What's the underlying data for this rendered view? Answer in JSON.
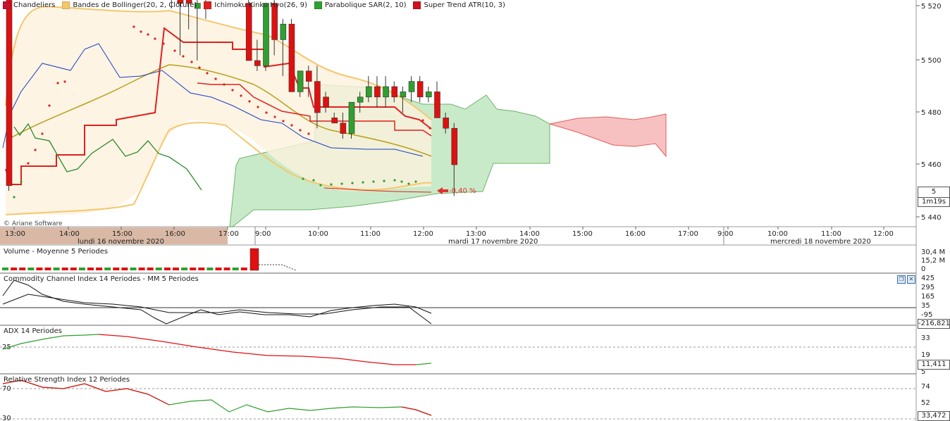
{
  "legend": [
    {
      "label": "Chandeliers",
      "color": "#c8102e"
    },
    {
      "label": "Bandes de Bollinger(20, 2, Clôture)",
      "color": "#f5c76a"
    },
    {
      "label": "Ichimoku Kinko Hyo(26, 9)",
      "color": "#e02020"
    },
    {
      "label": "Parabolique SAR(2, 10)",
      "color": "#2fa02f"
    },
    {
      "label": "Super Trend ATR(10, 3)",
      "color": "#d0101c"
    }
  ],
  "brand": "© Ariane Software",
  "price_badge": "5 449,80",
  "timer_badge": "1m19s",
  "pct_change": "-0,40 %",
  "panes": {
    "volume_title": "Volume  - Moyenne 5 Periodes",
    "cci_title": "Commodity Channel Index 14 Periodes - MM  5 Periodes",
    "adx_title": "ADX 14 Periodes",
    "rsi_title": "Relative Strength Index 12 Periodes",
    "cci_badge": "-216,821",
    "adx_badge": "11,411",
    "rsi_badge": "33,472"
  },
  "controls": {
    "restore_icon": "restore-icon",
    "close_icon": "close-icon"
  },
  "chart_data": {
    "type": "candlestick",
    "price_axis_ticks": [
      "5 520",
      "5 500",
      "5 480",
      "5 460",
      "5 440"
    ],
    "price_ylim": [
      5440,
      5520
    ],
    "time_ticks": [
      "13:00",
      "14:00",
      "15:00",
      "16:00",
      "17:00",
      "9:00",
      "10:00",
      "11:00",
      "12:00",
      "13:00",
      "14:00",
      "15:00",
      "16:00",
      "17:00",
      "9:00",
      "10:00",
      "11:00",
      "12:00"
    ],
    "date_labels": [
      "lundi 16 novembre 2020",
      "mardi 17 novembre 2020",
      "mercredi 18 novembre 2020"
    ],
    "candles": [
      [
        5501,
        5502,
        5445,
        5446
      ],
      [
        5502,
        5518,
        5498,
        5501
      ],
      [
        5502,
        5512,
        5498,
        5504
      ],
      [
        5501,
        5520,
        5499,
        5516
      ],
      [
        5512,
        5521,
        5500,
        5502
      ],
      [
        5504,
        5508,
        5499,
        5502
      ],
      [
        5502,
        5505,
        5498,
        5500
      ],
      [
        5500,
        5502,
        5494,
        5497
      ],
      [
        5495,
        5500,
        5493,
        5497
      ],
      [
        5497,
        5504,
        5494,
        5508
      ],
      [
        5508,
        5511,
        5505,
        5510
      ],
      [
        5510,
        5511,
        5499,
        5504
      ],
      [
        5499,
        5501,
        5491,
        5498
      ],
      [
        5498,
        5500,
        5494,
        5497
      ],
      [
        5497,
        5502,
        5495,
        5500
      ],
      [
        5500,
        5508,
        5496,
        5507
      ],
      [
        5507,
        5508,
        5499,
        5503
      ],
      [
        5504,
        5506,
        5496,
        5506
      ],
      [
        5506,
        5507,
        5487,
        5494
      ],
      [
        5492,
        5494,
        5480,
        5486
      ],
      [
        5486,
        5488,
        5471,
        5481
      ],
      [
        5482,
        5484,
        5476,
        5481
      ],
      [
        5480,
        5485,
        5470,
        5481
      ],
      [
        5482,
        5484,
        5478,
        5484
      ],
      [
        5484,
        5490,
        5483,
        5490
      ],
      [
        5488,
        5489,
        5484,
        5488
      ],
      [
        5490,
        5493,
        5484,
        5491
      ],
      [
        5488,
        5489,
        5483,
        5486
      ],
      [
        5481,
        5484,
        5470,
        5470
      ],
      [
        5470,
        5474,
        5468,
        5469
      ],
      [
        5469,
        5481,
        5468,
        5481
      ],
      [
        5481,
        5482,
        5471,
        5474
      ],
      [
        5474,
        5478,
        5467,
        5477
      ],
      [
        5477,
        5478,
        5468,
        5464
      ],
      [
        5464,
        5468,
        5463,
        5468
      ],
      [
        5468,
        5469,
        5463,
        5466
      ],
      [
        5466,
        5469,
        5457,
        5460
      ],
      [
        5463,
        5464,
        5460,
        5461
      ],
      [
        5459,
        5460,
        5458,
        5458
      ],
      [
        5458,
        5460,
        5455,
        5456
      ],
      [
        5456,
        5462,
        5455,
        5462
      ],
      [
        5462,
        5464,
        5460,
        5463
      ],
      [
        5463,
        5467,
        5462,
        5465
      ],
      [
        5465,
        5467,
        5461,
        5463
      ],
      [
        5463,
        5467,
        5461,
        5465
      ],
      [
        5465,
        5466,
        5462,
        5463
      ],
      [
        5463,
        5465,
        5460,
        5464
      ],
      [
        5464,
        5467,
        5462,
        5466
      ],
      [
        5466,
        5467,
        5462,
        5463
      ],
      [
        5463,
        5465,
        5462,
        5464
      ],
      [
        5464,
        5466,
        5460,
        5459
      ],
      [
        5459,
        5460,
        5456,
        5457
      ],
      [
        5457,
        5458,
        5444,
        5450
      ]
    ],
    "volume_axis": [
      "30,4 M",
      "15,2 M",
      "0"
    ],
    "cci_axis": [
      "425",
      "295",
      "165",
      "35",
      "-95"
    ],
    "adx_axis": [
      "33",
      "19",
      "5"
    ],
    "adx_levels": [
      "25"
    ],
    "rsi_axis": [
      "74",
      "52"
    ],
    "rsi_levels": [
      "70",
      "30"
    ]
  }
}
